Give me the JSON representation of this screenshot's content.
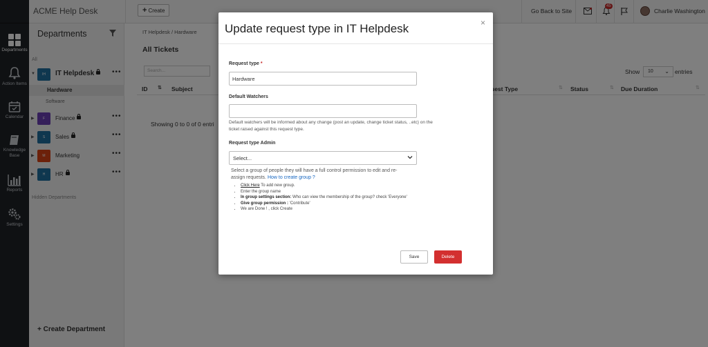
{
  "topbar": {
    "brand": "ACME Help Desk",
    "create_label": "Create",
    "go_back": "Go Back to Site",
    "notif_badge": "45",
    "user_name": "Charlie Washington"
  },
  "rail": {
    "items": [
      {
        "label": "Departments"
      },
      {
        "label": "Action Items"
      },
      {
        "label": "Calendar"
      },
      {
        "label": "Knowledge Base"
      },
      {
        "label": "Reports"
      },
      {
        "label": "Settings"
      }
    ]
  },
  "departments": {
    "title": "Departments",
    "all_label": "All",
    "items": [
      {
        "initials": "IH",
        "name": "IT Helpdesk",
        "color": "#1f6f9f",
        "locked": true
      },
      {
        "initials": "F",
        "name": "Finance",
        "color": "#6a3fb5",
        "locked": true
      },
      {
        "initials": "S",
        "name": "Sales",
        "color": "#1f6f9f",
        "locked": true
      },
      {
        "initials": "M",
        "name": "Marketing",
        "color": "#d84315",
        "locked": false
      },
      {
        "initials": "H",
        "name": "HR",
        "color": "#1f6f9f",
        "locked": true
      }
    ],
    "sub_items": [
      "Hardware",
      "Software"
    ],
    "hidden_label": "Hidden Departments",
    "create_label": "+ Create Department"
  },
  "main": {
    "breadcrumb": "IT Helpdesk / Hardware",
    "title": "All Tickets",
    "search_placeholder": "Search...",
    "show_label": "Show",
    "show_value": "10",
    "entries_label": "entries",
    "columns": [
      "ID",
      "Subject",
      "uest Type",
      "Status",
      "Due Duration"
    ],
    "showing": "Showing 0 to 0 of 0 entri"
  },
  "modal": {
    "title": "Update request type in IT Helpdesk",
    "close": "×",
    "request_type_label": "Request type",
    "required_mark": "*",
    "request_type_value": "Hardware",
    "watchers_label": "Default Watchers",
    "watchers_value": "",
    "watchers_help": "Default watchers will be informed about any change (post an update, change ticket status, ..etc) on the ticket raised against this request type.",
    "admin_label": "Request type Admin",
    "admin_value": "Select...",
    "group_help": "Select a group of people they will have a full control permission to edit and re-assign requests.",
    "group_help_link": "How to create group ?",
    "steps": {
      "s1_link": "Click Here",
      "s1_text": " To add new group.",
      "s2": "Enter the group name",
      "s3_bold": "In group settings section:",
      "s3_text": " Who can view the membership of the group? check 'Everyone'",
      "s4_bold": "Give group permission :",
      "s4_text": " 'Contribute'",
      "s5": "We are Done ! , click Create"
    },
    "save_label": "Save",
    "delete_label": "Delete"
  }
}
